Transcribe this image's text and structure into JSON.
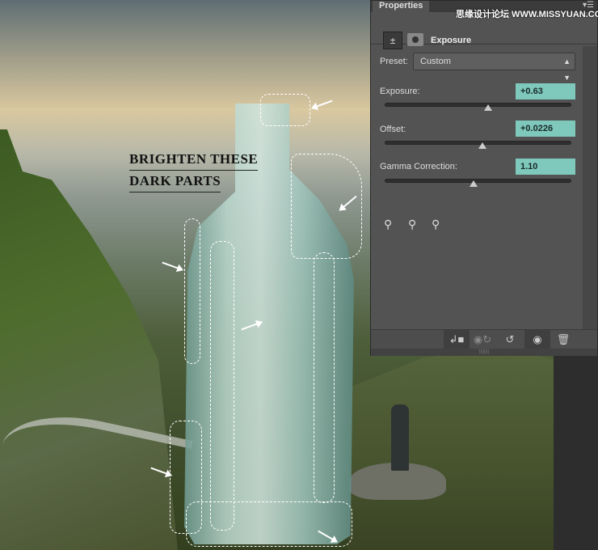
{
  "annotation": {
    "line1": "BRIGHTEN THESE",
    "line2": "DARK PARTS"
  },
  "panel": {
    "tab": "Properties",
    "menu_icon": "panel-menu-icon",
    "watermark": "思缘设计论坛  WWW.MISSYUAN.COM",
    "adjustment_title": "Exposure",
    "preset": {
      "label": "Preset:",
      "value": "Custom"
    },
    "exposure": {
      "label": "Exposure:",
      "value": "+0.63",
      "slider_fraction": 0.55
    },
    "offset": {
      "label": "Offset:",
      "value": "+0.0226",
      "slider_fraction": 0.52
    },
    "gamma": {
      "label": "Gamma Correction:",
      "value": "1.10",
      "slider_fraction": 0.47
    },
    "eyedroppers": [
      "black-point-eyedropper-icon",
      "gray-point-eyedropper-icon",
      "white-point-eyedropper-icon"
    ],
    "footer": [
      "clip-to-layer-icon",
      "view-previous-state-icon",
      "reset-icon",
      "visibility-eye-icon",
      "trash-icon"
    ]
  },
  "colors": {
    "value_field": "#7fc8bc",
    "panel_bg": "#535353"
  }
}
